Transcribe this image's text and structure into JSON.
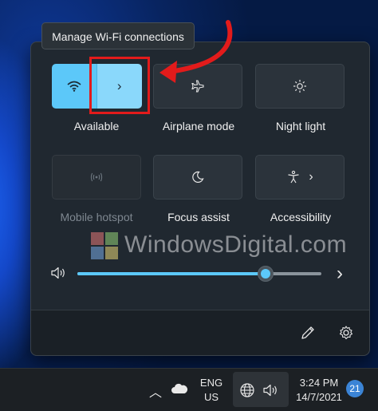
{
  "tooltip": "Manage Wi-Fi connections",
  "watermark": "WindowsDigital.com",
  "quick_settings": {
    "row1": [
      {
        "label": "Available"
      },
      {
        "label": "Airplane mode"
      },
      {
        "label": "Night light"
      }
    ],
    "row2": [
      {
        "label": "Mobile hotspot"
      },
      {
        "label": "Focus assist"
      },
      {
        "label": "Accessibility"
      }
    ]
  },
  "volume": {
    "level_percent": 77
  },
  "taskbar": {
    "lang_line1": "ENG",
    "lang_line2": "US",
    "time": "3:24 PM",
    "date": "14/7/2021",
    "notification_count": "21"
  },
  "colors": {
    "accent": "#5cc8f9",
    "annotation": "#e21b1b",
    "panel": "#202830"
  },
  "icons": [
    "wifi-icon",
    "chevron-right-icon",
    "airplane-icon",
    "brightness-icon",
    "hotspot-icon",
    "moon-icon",
    "accessibility-icon",
    "speaker-icon",
    "edit-icon",
    "gear-icon",
    "chevron-up-icon",
    "cloud-icon",
    "globe-icon",
    "volume-icon"
  ]
}
